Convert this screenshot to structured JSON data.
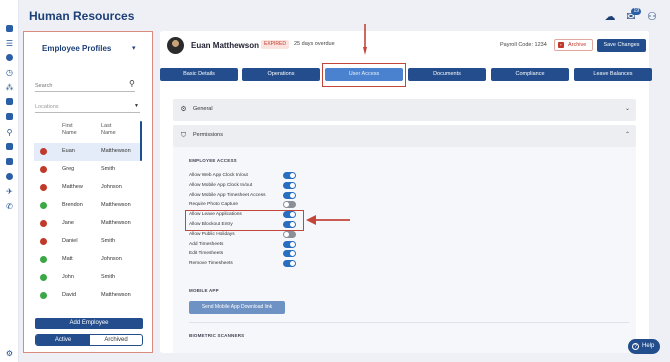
{
  "app": {
    "title": "Human Resources"
  },
  "header": {
    "notification_count": "19"
  },
  "employees": {
    "title": "Employee Profiles",
    "search_placeholder": "Search",
    "locations_placeholder": "Locations",
    "columns": {
      "first": "First Name",
      "last": "Last Name"
    },
    "rows": [
      {
        "first": "Euan",
        "last": "Matthewson",
        "status_color": "#c0392b",
        "selected": true
      },
      {
        "first": "Greg",
        "last": "Smith",
        "status_color": "#c0392b"
      },
      {
        "first": "Matthew",
        "last": "Johnson",
        "status_color": "#c0392b"
      },
      {
        "first": "Brendon",
        "last": "Matthewson",
        "status_color": "#3aa845"
      },
      {
        "first": "Jane",
        "last": "Matthewson",
        "status_color": "#c0392b"
      },
      {
        "first": "Daniel",
        "last": "Smith",
        "status_color": "#c0392b"
      },
      {
        "first": "Matt",
        "last": "Johnson",
        "status_color": "#3aa845"
      },
      {
        "first": "John",
        "last": "Smith",
        "status_color": "#3aa845"
      },
      {
        "first": "David",
        "last": "Matthewson",
        "status_color": "#3aa845"
      }
    ],
    "add_button": "Add Employee",
    "toggle": {
      "active": "Active",
      "archived": "Archived"
    }
  },
  "profile": {
    "name": "Euan Matthewson",
    "status_badge": "EXPIRED",
    "overdue": "25 days overdue",
    "payroll": "Payroll Code:  1234",
    "archive": "Archive",
    "save": "Save Changes"
  },
  "tabs": [
    {
      "label": "Basic Details"
    },
    {
      "label": "Operations"
    },
    {
      "label": "User Access",
      "active": true
    },
    {
      "label": "Documents"
    },
    {
      "label": "Compliance"
    },
    {
      "label": "Leave Balances"
    }
  ],
  "sections": {
    "general": "General",
    "permissions": "Permissions",
    "employee_access": "EMPLOYEE ACCESS",
    "mobile_app": "MOBILE APP",
    "mobile_button": "Send Mobile App Download link",
    "biometric": "BIOMETRIC SCANNERS"
  },
  "permissions": [
    {
      "label": "Allow Web App Clock In/out",
      "on": true
    },
    {
      "label": "Allow Mobile App Clock In/out",
      "on": true
    },
    {
      "label": "Allow Mobile App Timesheet Access",
      "on": true
    },
    {
      "label": "Require Photo Capture",
      "on": false
    },
    {
      "label": "Allow Leave Applications",
      "on": true
    },
    {
      "label": "Allow Blockout Entry",
      "on": true
    },
    {
      "label": "Allow Public Holidays",
      "on": false
    },
    {
      "label": "Add Timesheets",
      "on": true
    },
    {
      "label": "Edit Timesheets",
      "on": true
    },
    {
      "label": "Remove Timesheets",
      "on": true
    }
  ],
  "help": "Help",
  "colors": {
    "primary": "#234d8c",
    "active_tab": "#4a82cf",
    "highlight": "#c4453a",
    "toggle_on": "#2a6fbf",
    "toggle_off": "#8a8f99"
  }
}
